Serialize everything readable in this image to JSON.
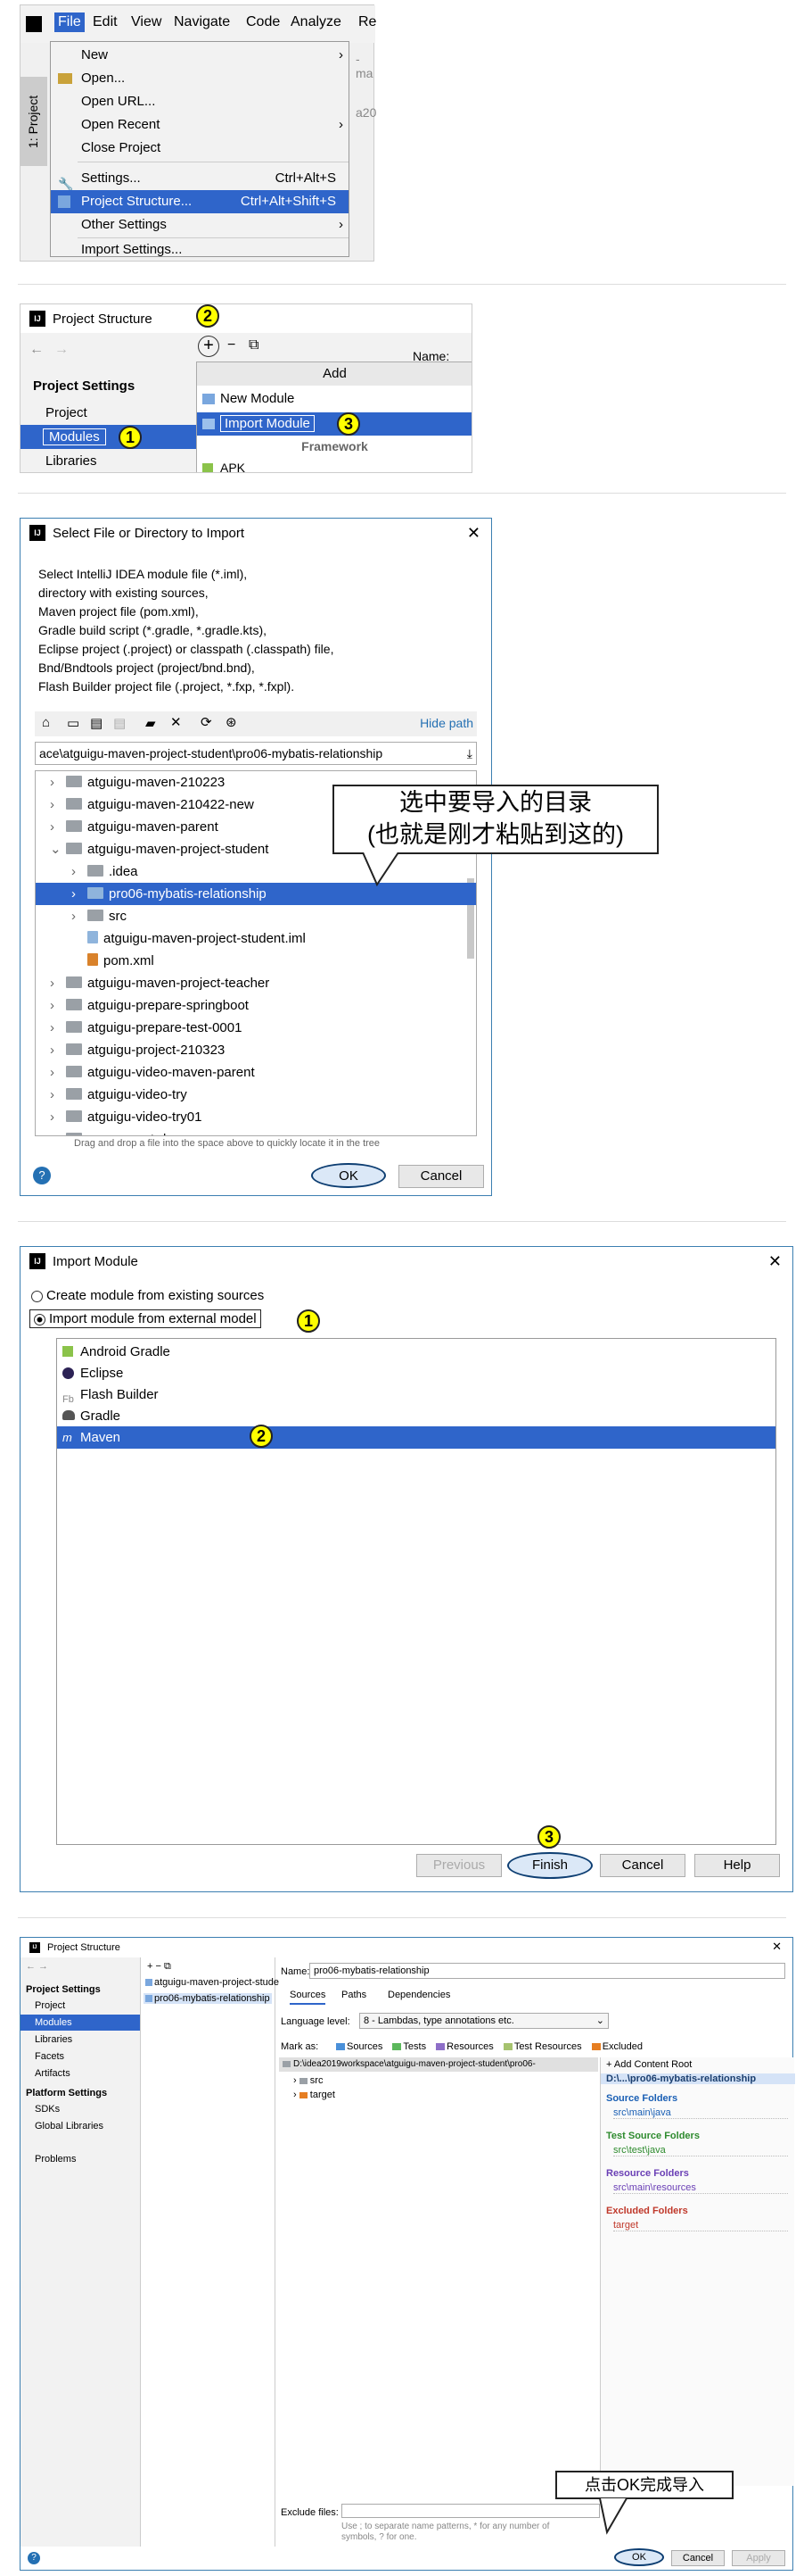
{
  "s1": {
    "menubar": [
      "File",
      "Edit",
      "View",
      "Navigate",
      "Code",
      "Analyze",
      "Re"
    ],
    "side_tab": "1: Project",
    "items": [
      {
        "label": "New",
        "arrow": true
      },
      {
        "label": "Open...",
        "sc": ""
      },
      {
        "label": "Open URL..."
      },
      {
        "label": "Open Recent",
        "arrow": true
      },
      {
        "label": "Close Project"
      },
      {
        "label": "Settings...",
        "sc": "Ctrl+Alt+S"
      },
      {
        "label": "Project Structure...",
        "sc": "Ctrl+Alt+Shift+S"
      },
      {
        "label": "Other Settings",
        "arrow": true
      },
      {
        "label": "Import Settings..."
      }
    ],
    "bg_frag1": "-ma",
    "bg_frag2": "a20"
  },
  "s2": {
    "title": "Project Structure",
    "section": "Project Settings",
    "nav": [
      "Project",
      "Modules",
      "Libraries"
    ],
    "add_header": "Add",
    "new_module": "New Module",
    "import_module": "Import Module",
    "framework": "Framework",
    "apk": "APK",
    "name_frag": "Name:",
    "c1": "1",
    "c2": "2",
    "c3": "3"
  },
  "s3": {
    "title": "Select File or Directory to Import",
    "desc": [
      "Select IntelliJ IDEA module file (*.iml),",
      "directory with existing sources,",
      "Maven project file (pom.xml),",
      "Gradle build script (*.gradle, *.gradle.kts),",
      "Eclipse project (.project) or classpath (.classpath) file,",
      "Bnd/Bndtools project (project/bnd.bnd),",
      "Flash Builder project file (.project, *.fxp, *.fxpl)."
    ],
    "hide_path": "Hide path",
    "path": "ace\\atguigu-maven-project-student\\pro06-mybatis-relationship",
    "tree": [
      {
        "t": "atguigu-maven-210223",
        "l": 1
      },
      {
        "t": "atguigu-maven-210422-new",
        "l": 1
      },
      {
        "t": "atguigu-maven-parent",
        "l": 1
      },
      {
        "t": "atguigu-maven-project-student",
        "l": 1,
        "open": true
      },
      {
        "t": ".idea",
        "l": 2
      },
      {
        "t": "pro06-mybatis-relationship",
        "l": 2,
        "sel": true
      },
      {
        "t": "src",
        "l": 2
      },
      {
        "t": "atguigu-maven-project-student.iml",
        "l": 2,
        "file": true
      },
      {
        "t": "pom.xml",
        "l": 2,
        "file": true
      },
      {
        "t": "atguigu-maven-project-teacher",
        "l": 1
      },
      {
        "t": "atguigu-prepare-springboot",
        "l": 1
      },
      {
        "t": "atguigu-prepare-test-0001",
        "l": 1
      },
      {
        "t": "atguigu-project-210323",
        "l": 1
      },
      {
        "t": "atguigu-video-maven-parent",
        "l": 1
      },
      {
        "t": "atguigu-video-try",
        "l": 1
      },
      {
        "t": "atguigu-video-try01",
        "l": 1
      },
      {
        "t": "maven-rest-demo",
        "l": 1
      }
    ],
    "drag_hint": "Drag and drop a file into the space above to quickly locate it in the tree",
    "ok": "OK",
    "cancel": "Cancel",
    "callout1": "选中要导入的目录",
    "callout2": "(也就是刚才粘贴到这的)"
  },
  "s4": {
    "title": "Import Module",
    "opt1": "Create module from existing sources",
    "opt2": "Import module from external model",
    "models": [
      "Android Gradle",
      "Eclipse",
      "Flash Builder",
      "Gradle",
      "Maven"
    ],
    "previous": "Previous",
    "finish": "Finish",
    "cancel": "Cancel",
    "help": "Help"
  },
  "s5": {
    "title": "Project Structure",
    "ps": "Project Settings",
    "ps_items": [
      "Project",
      "Modules",
      "Libraries",
      "Facets",
      "Artifacts"
    ],
    "plat": "Platform Settings",
    "plat_items": [
      "SDKs",
      "Global Libraries"
    ],
    "problems": "Problems",
    "modules": [
      "atguigu-maven-project-stude",
      "pro06-mybatis-relationship"
    ],
    "name_label": "Name:",
    "name_val": "pro06-mybatis-relationship",
    "tabs": [
      "Sources",
      "Paths",
      "Dependencies"
    ],
    "lang_label": "Language level:",
    "lang_val": "8 - Lambdas, type annotations etc.",
    "markas": "Mark as:",
    "marks": [
      "Sources",
      "Tests",
      "Resources",
      "Test Resources",
      "Excluded"
    ],
    "root_path": "D:\\idea2019workspace\\atguigu-maven-project-student\\pro06-",
    "tree": [
      "src",
      "target"
    ],
    "add_root": "+ Add Content Root",
    "root_short": "D:\\...\\pro06-mybatis-relationship",
    "groups": [
      {
        "h": "Source Folders",
        "v": "src\\main\\java",
        "c": "#1a5fb4"
      },
      {
        "h": "Test Source Folders",
        "v": "src\\test\\java",
        "c": "#2e8b2e"
      },
      {
        "h": "Resource Folders",
        "v": "src\\main\\resources",
        "c": "#6a3fb5"
      },
      {
        "h": "Excluded Folders",
        "v": "target",
        "c": "#c0392b"
      }
    ],
    "exclude_label": "Exclude files:",
    "exclude_hint1": "Use ; to separate name patterns, * for any number of",
    "exclude_hint2": "symbols, ? for one.",
    "ok": "OK",
    "cancel": "Cancel",
    "apply": "Apply",
    "callout": "点击OK完成导入"
  }
}
